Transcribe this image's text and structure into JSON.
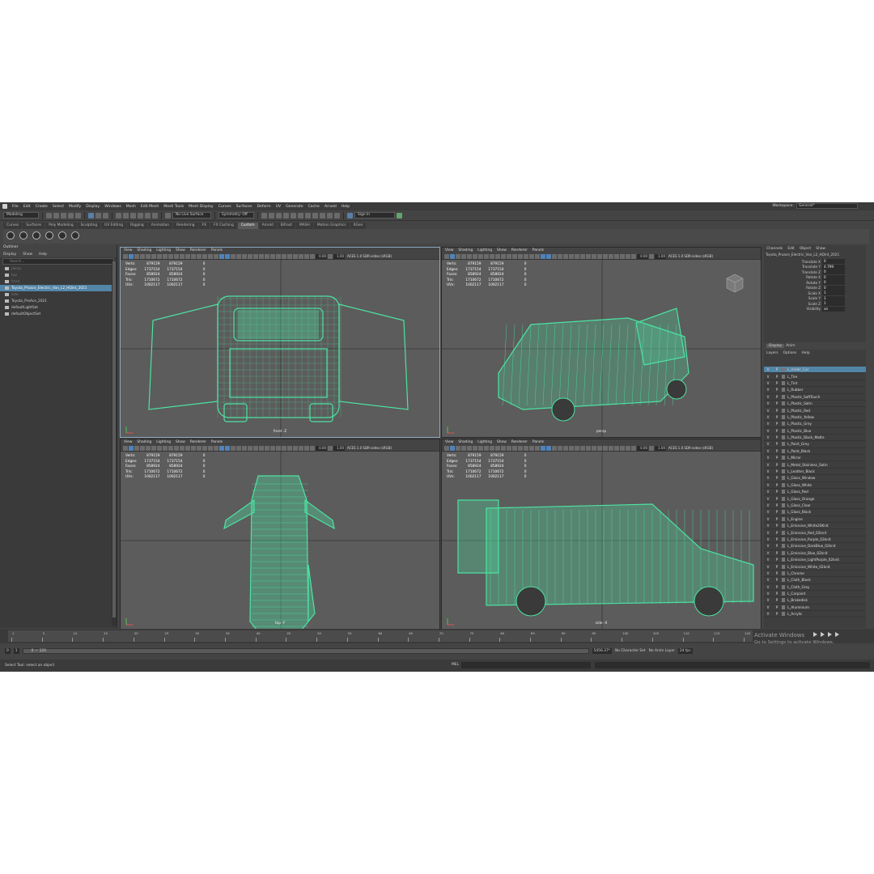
{
  "menubar": [
    "File",
    "Edit",
    "Create",
    "Select",
    "Modify",
    "Display",
    "Windows",
    "Mesh",
    "Edit Mesh",
    "Mesh Tools",
    "Mesh Display",
    "Curves",
    "Surfaces",
    "Deform",
    "UV",
    "Generate",
    "Cache",
    "Arnold",
    "Help"
  ],
  "workspace": {
    "label": "Workspace:",
    "value": "General*"
  },
  "toolbar": {
    "mode": "Modeling",
    "live_surface": "No Live Surface",
    "symmetry": "Symmetry: Off",
    "sign_in": "Sign In"
  },
  "shelf_tabs": [
    "Curves",
    "Surfaces",
    "Poly Modeling",
    "Sculpting",
    "UV Editing",
    "Rigging",
    "Animation",
    "Rendering",
    "FX",
    "FX Caching",
    "Custom",
    "Arnold",
    "Bifrost",
    "MASH",
    "Motion Graphics",
    "XGen"
  ],
  "shelf_active": "Custom",
  "outliner": {
    "title": "Outliner",
    "menu": [
      "Display",
      "Show",
      "Help"
    ],
    "search_placeholder": "Search...",
    "items": [
      {
        "label": "persp",
        "dim": true
      },
      {
        "label": "top",
        "dim": true
      },
      {
        "label": "front",
        "dim": true
      },
      {
        "label": "Toyota_Proace_Electric_Van_L2_HQint_2021",
        "selected": true
      },
      {
        "label": "side",
        "dim": true
      },
      {
        "label": "Toyota_ProAce_2021"
      },
      {
        "label": "defaultLightSet"
      },
      {
        "label": "defaultObjectSet"
      }
    ]
  },
  "viewport_menu": [
    "View",
    "Shading",
    "Lighting",
    "Show",
    "Renderer",
    "Panels"
  ],
  "viewport_fields": {
    "a": "0.00",
    "b": "1.00",
    "aces": "ACES 1.0 SDR-video (sRGB)"
  },
  "hud": {
    "rows": [
      {
        "label": "Verts:",
        "a": "879159",
        "b": "879159",
        "c": "0"
      },
      {
        "label": "Edges:",
        "a": "1737154",
        "b": "1737154",
        "c": "0"
      },
      {
        "label": "Faces:",
        "a": "858924",
        "b": "858924",
        "c": "0"
      },
      {
        "label": "Tris:",
        "a": "1710672",
        "b": "1710672",
        "c": "0"
      },
      {
        "label": "UVs:",
        "a": "1002117",
        "b": "1002117",
        "c": "0"
      }
    ]
  },
  "viewports": [
    {
      "label": "front -Z"
    },
    {
      "label": "persp"
    },
    {
      "label": "top -Y"
    },
    {
      "label": "side -X"
    }
  ],
  "channel_box": {
    "menu": [
      "Channels",
      "Edit",
      "Object",
      "Show"
    ],
    "object": "Toyota_Proace_Electric_Van_L2_HQint_2021",
    "attrs": [
      {
        "l": "Translate X",
        "v": "0"
      },
      {
        "l": "Translate Y",
        "v": "4.799"
      },
      {
        "l": "Translate Z",
        "v": "0"
      },
      {
        "l": "Rotate X",
        "v": "0"
      },
      {
        "l": "Rotate Y",
        "v": "0"
      },
      {
        "l": "Rotate Z",
        "v": "0"
      },
      {
        "l": "Scale X",
        "v": "1"
      },
      {
        "l": "Scale Y",
        "v": "1"
      },
      {
        "l": "Scale Z",
        "v": "1"
      },
      {
        "l": "Visibility",
        "v": "on"
      }
    ]
  },
  "layer_tabs": [
    "Display",
    "Anim"
  ],
  "layer_menu": [
    "Layers",
    "Options",
    "Help"
  ],
  "layers": [
    "L_Under_Car",
    "L_Tire",
    "L_Tint",
    "L_Rubber",
    "L_Plastic_SoftTouch",
    "L_Plastic_Satin",
    "L_Plastic_Red",
    "L_Plastic_Yellow",
    "L_Plastic_Grey",
    "L_Plastic_Blue",
    "L_Plastic_Black_Matte",
    "L_Paint_Grey",
    "L_Paint_Black",
    "L_Mirror",
    "L_Metal_Stainless_Satin",
    "L_Leather_Black",
    "L_Glass_Window",
    "L_Glass_White",
    "L_Glass_Red",
    "L_Glass_Orange",
    "L_Glass_Clear",
    "L_Glass_Black",
    "L_Engine",
    "L_Emissive_White20Knit",
    "L_Emissive_Red_02knit",
    "L_Emissive_Purple_02knit",
    "L_Emissive_DarkBlue_02knit",
    "L_Emissive_Blue_02knit",
    "L_Emissive_LightPurple_02knit",
    "L_Emissive_White_02knit",
    "L_Chrome",
    "L_Cloth_Black",
    "L_Cloth_Grey",
    "L_Carpaint",
    "L_Brakedisk",
    "L_Aluminium",
    "L_Acrylic"
  ],
  "timeline": {
    "ticks": [
      "1",
      "5",
      "10",
      "15",
      "20",
      "25",
      "30",
      "35",
      "40",
      "45",
      "50",
      "55",
      "60",
      "65",
      "70",
      "75",
      "80",
      "85",
      "90",
      "95",
      "100",
      "105",
      "110",
      "115",
      "120"
    ],
    "current": "1"
  },
  "range": {
    "start": "0",
    "start2": "1",
    "range_text": "0 — 120",
    "end": "5456.37*",
    "character_set": "No Character Set",
    "anim_layer": "No Anim Layer",
    "fps": "24 fps"
  },
  "status": {
    "message": "Select Tool: select an object",
    "mel": "MEL"
  },
  "watermark": {
    "line1": "Activate Windows",
    "line2": "Go to Settings to activate Windows."
  }
}
